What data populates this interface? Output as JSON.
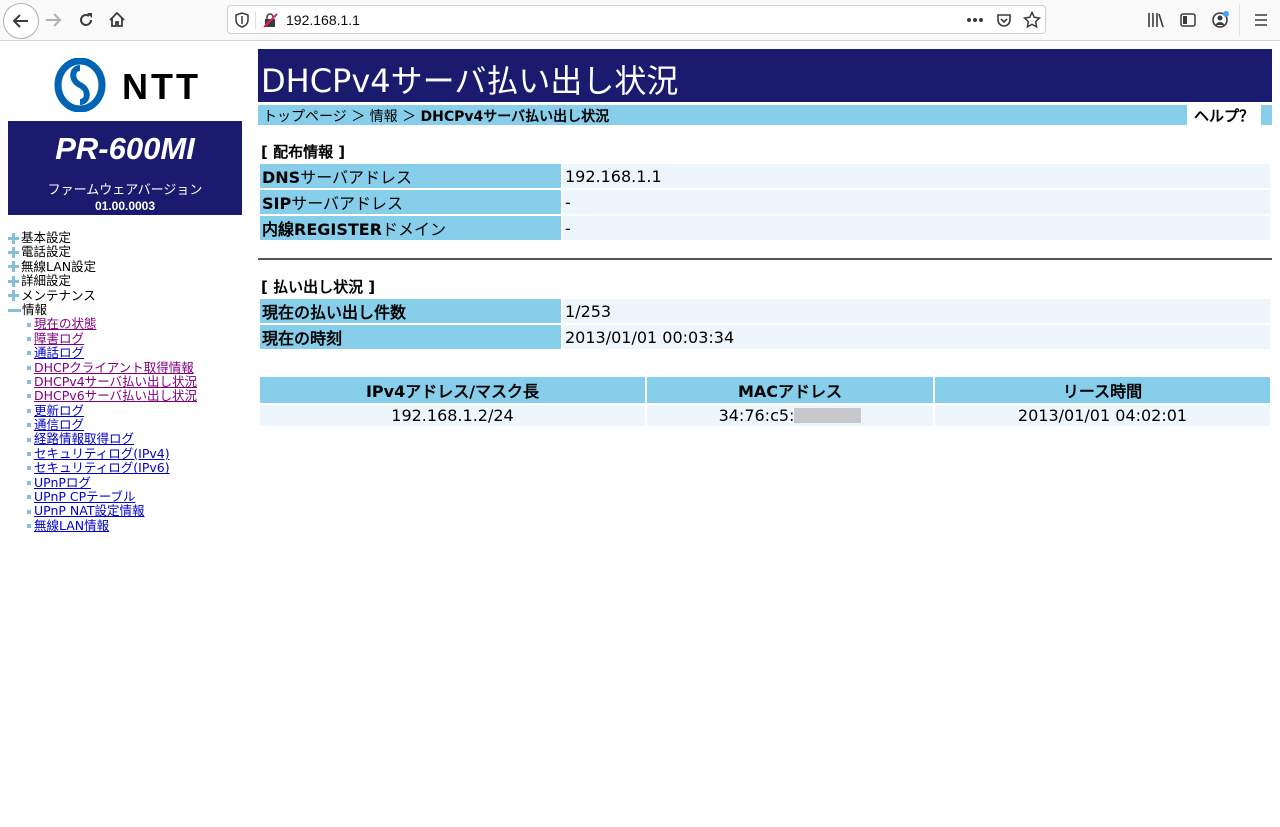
{
  "browser": {
    "url": "192.168.1.1"
  },
  "sidebar": {
    "logo_text": "NTT",
    "model": "PR-600MI",
    "firmware_label": "ファームウェアバージョン",
    "firmware_version": "01.00.0003",
    "menu": [
      {
        "label": "基本設定",
        "expanded": false
      },
      {
        "label": "電話設定",
        "expanded": false
      },
      {
        "label": "無線LAN設定",
        "expanded": false
      },
      {
        "label": "詳細設定",
        "expanded": false
      },
      {
        "label": "メンテナンス",
        "expanded": false
      },
      {
        "label": "情報",
        "expanded": true
      }
    ],
    "info_items": [
      {
        "label": "現在の状態",
        "visited": true
      },
      {
        "label": "障害ログ",
        "visited": true
      },
      {
        "label": "通話ログ",
        "visited": false
      },
      {
        "label": "DHCPクライアント取得情報",
        "visited": true
      },
      {
        "label": "DHCPv4サーバ払い出し状況",
        "visited": true
      },
      {
        "label": "DHCPv6サーバ払い出し状況",
        "visited": true
      },
      {
        "label": "更新ログ",
        "visited": false
      },
      {
        "label": "通信ログ",
        "visited": false
      },
      {
        "label": "経路情報取得ログ",
        "visited": false
      },
      {
        "label": "セキュリティログ(IPv4)",
        "visited": false
      },
      {
        "label": "セキュリティログ(IPv6)",
        "visited": false
      },
      {
        "label": "UPnPログ",
        "visited": false
      },
      {
        "label": "UPnP CPテーブル",
        "visited": false
      },
      {
        "label": "UPnP NAT設定情報",
        "visited": false
      },
      {
        "label": "無線LAN情報",
        "visited": false
      }
    ]
  },
  "main": {
    "title": "DHCPv4サーバ払い出し状況",
    "breadcrumb": {
      "home": "トップページ",
      "sep": "＞",
      "parent": "情報",
      "current": "DHCPv4サーバ払い出し状況"
    },
    "help_label": "ヘルプ？",
    "distribution": {
      "heading": "[ 配布情報 ]",
      "rows": [
        {
          "key_bold": "DNS",
          "key_rest": "サーバアドレス",
          "value": "192.168.1.1"
        },
        {
          "key_bold": "SIP",
          "key_rest": "サーバアドレス",
          "value": "-"
        },
        {
          "key_bold": "内線REGISTER",
          "key_rest": "ドメイン",
          "value": "-"
        }
      ]
    },
    "status": {
      "heading": "[ 払い出し状況 ]",
      "rows": [
        {
          "key": "現在の払い出し件数",
          "value": "1/253"
        },
        {
          "key": "現在の時刻",
          "value": "2013/01/01 00:03:34"
        }
      ]
    },
    "leases": {
      "headers": [
        "IPv4アドレス/マスク長",
        "MACアドレス",
        "リース時間"
      ],
      "rows": [
        {
          "ip": "192.168.1.2/24",
          "mac_prefix": "34:76:c5:",
          "lease": "2013/01/01 04:02:01"
        }
      ]
    }
  }
}
